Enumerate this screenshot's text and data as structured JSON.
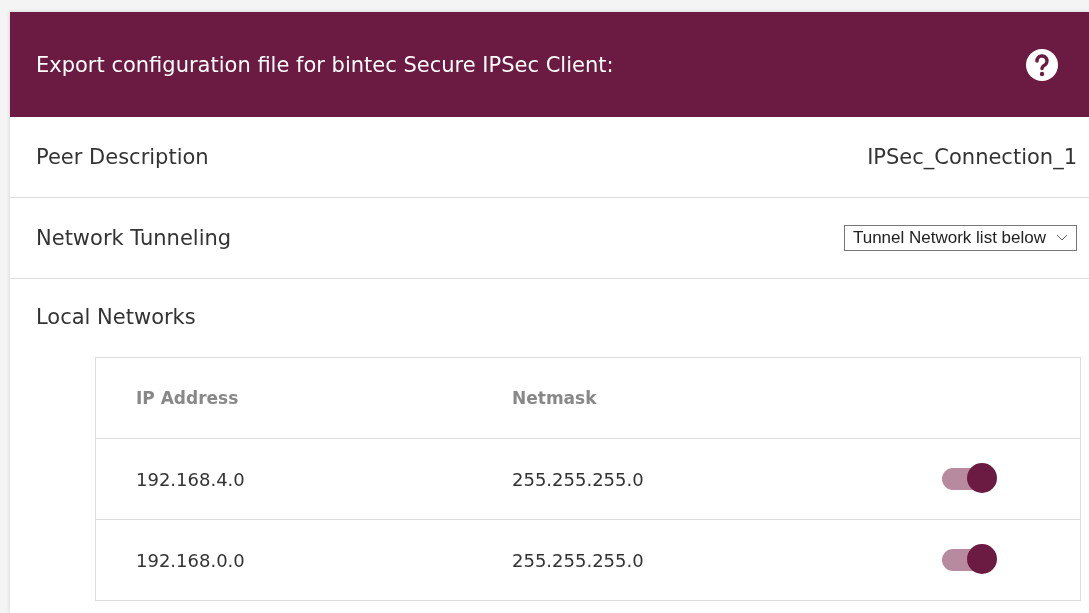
{
  "panel": {
    "title": "Export configuration file for bintec Secure IPSec Client:",
    "help_icon": true
  },
  "fields": [
    {
      "kind": "text",
      "label": "Peer Description",
      "value": "IPSec_Connection_1"
    },
    {
      "kind": "select",
      "label": "Network Tunneling",
      "value": "Tunnel Network list below"
    }
  ],
  "local_networks": {
    "label": "Local Networks",
    "columns": [
      "IP Address",
      "Netmask"
    ],
    "rows": [
      {
        "ip": "192.168.4.0",
        "netmask": "255.255.255.0",
        "on": true
      },
      {
        "ip": "192.168.0.0",
        "netmask": "255.255.255.0",
        "on": true
      }
    ]
  }
}
